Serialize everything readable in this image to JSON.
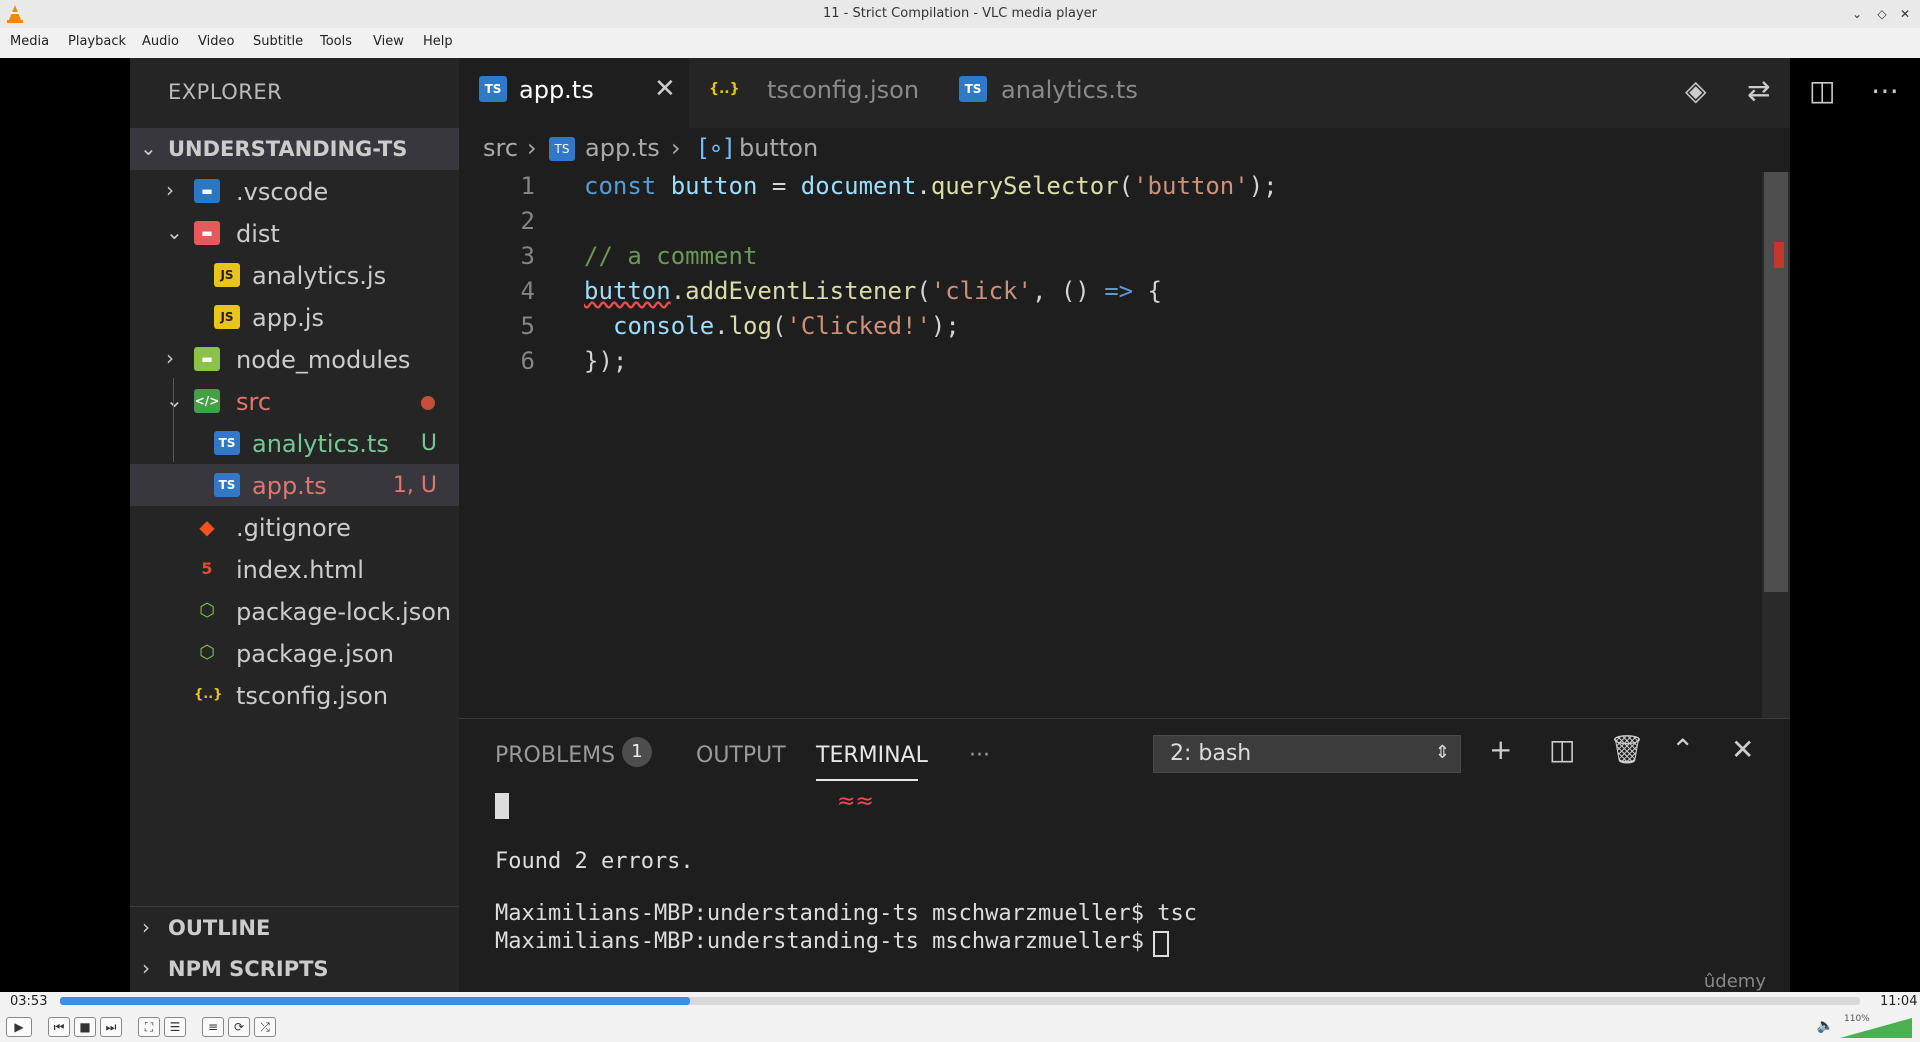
{
  "window": {
    "title": "11 - Strict Compilation - VLC media player"
  },
  "menu": [
    "Media",
    "Playback",
    "Audio",
    "Video",
    "Subtitle",
    "Tools",
    "View",
    "Help"
  ],
  "sidebar": {
    "title": "EXPLORER",
    "project": "UNDERSTANDING-TS",
    "items": [
      {
        "label": ".vscode",
        "badge": ""
      },
      {
        "label": "dist",
        "badge": ""
      },
      {
        "label": "analytics.js",
        "badge": ""
      },
      {
        "label": "app.js",
        "badge": ""
      },
      {
        "label": "node_modules",
        "badge": ""
      },
      {
        "label": "src",
        "badge": ""
      },
      {
        "label": "analytics.ts",
        "badge": "U"
      },
      {
        "label": "app.ts",
        "badge": "1, U"
      },
      {
        "label": ".gitignore",
        "badge": ""
      },
      {
        "label": "index.html",
        "badge": ""
      },
      {
        "label": "package-lock.json",
        "badge": ""
      },
      {
        "label": "package.json",
        "badge": ""
      },
      {
        "label": "tsconfig.json",
        "badge": ""
      }
    ],
    "outline": "OUTLINE",
    "npm_scripts": "NPM SCRIPTS"
  },
  "tabs": [
    {
      "label": "app.ts",
      "icon": "TS"
    },
    {
      "label": "tsconfig.json",
      "icon": "{..}"
    },
    {
      "label": "analytics.ts",
      "icon": "TS"
    }
  ],
  "breadcrumb": {
    "folder": "src",
    "file": "app.ts",
    "symbol": "button"
  },
  "code": {
    "line_numbers": [
      "1",
      "2",
      "3",
      "4",
      "5",
      "6"
    ],
    "l1": {
      "kw": "const",
      "var": "button",
      "eq": " = ",
      "obj": "document",
      "fn": "querySelector",
      "str": "'button'",
      "end": ");"
    },
    "l3": {
      "comment": "// a comment"
    },
    "l4": {
      "var": "button",
      "fn": "addEventListener",
      "str": "'click'",
      "arrow": "=>",
      "rest": ", () ",
      "brace": " {"
    },
    "l5": {
      "obj": "console",
      "fn": "log",
      "str": "'Clicked!'",
      "end": ");"
    },
    "l6": {
      "text": "});"
    }
  },
  "panel": {
    "problems": "PROBLEMS",
    "problems_count": "1",
    "output": "OUTPUT",
    "terminal": "TERMINAL",
    "more": "···",
    "shell": "2: bash",
    "lines": [
      "Found 2 errors.",
      "Maximilians-MBP:understanding-ts mschwarzmueller$ tsc",
      "Maximilians-MBP:understanding-ts mschwarzmueller$ "
    ],
    "watermark": "ûdemy"
  },
  "player": {
    "elapsed": "03:53",
    "total": "11:04",
    "progress": 0.35,
    "volume": "110%"
  }
}
